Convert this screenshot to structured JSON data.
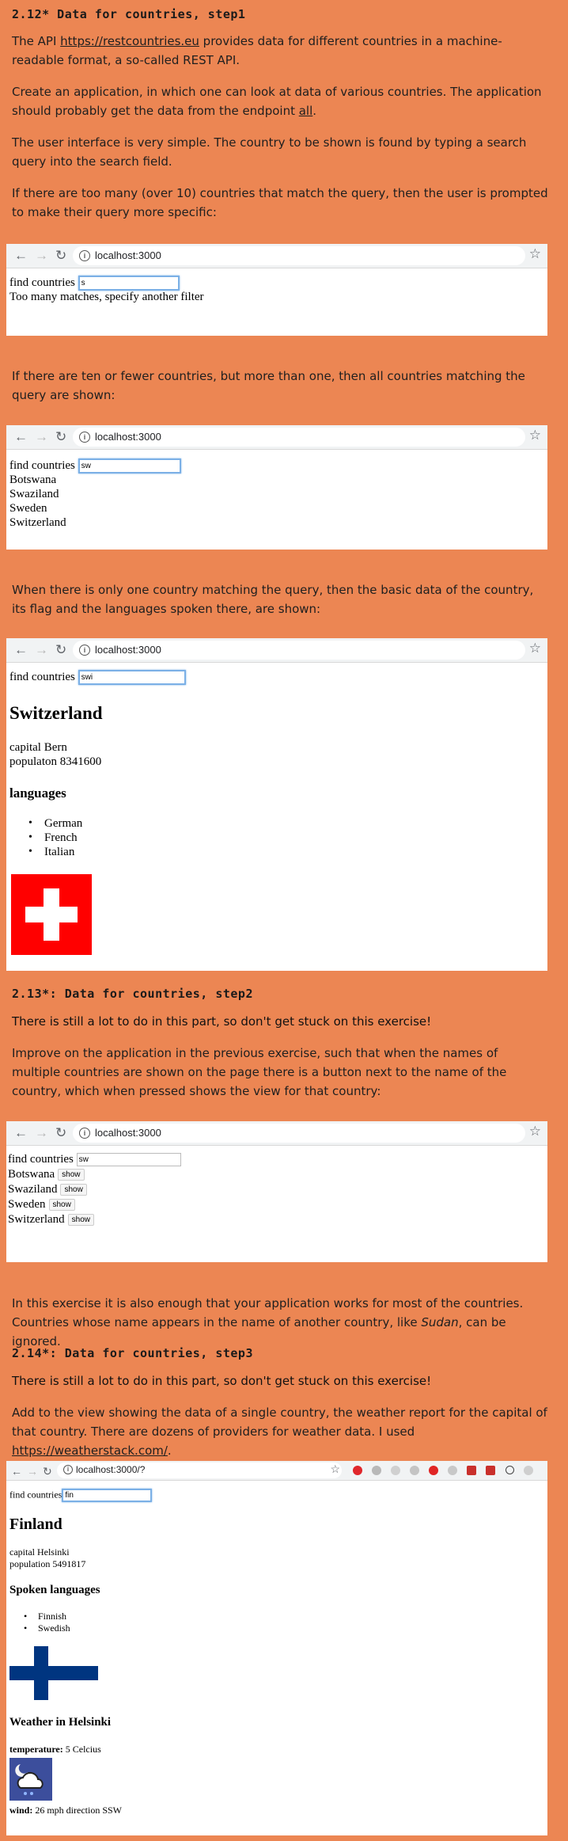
{
  "section1": {
    "title": "2.12* Data for countries, step1",
    "p1_a": "The API ",
    "p1_link": "https://restcountries.eu",
    "p1_b": " provides data for different countries in a machine-readable format, a so-called REST API.",
    "p2_a": "Create an application, in which one can look at data of various countries. The application should probably get the data from the endpoint ",
    "p2_link": "all",
    "p2_b": ".",
    "p3": "The user interface is very simple. The country to be shown is found by typing a search query into the search field.",
    "p4": "If there are too many (over 10) countries that match the query, then the user is prompted to make their query more specific:",
    "p5": "If there are ten or fewer countries, but more than one, then all countries matching the query are shown:",
    "p6": "When there is only one country matching the query, then the basic data of the country, its flag and the languages spoken there, are shown:"
  },
  "browser": {
    "url": "localhost:3000",
    "url2": "localhost:3000/?"
  },
  "shot1": {
    "find_label": "find countries",
    "query": "s",
    "message": "Too many matches, specify another filter"
  },
  "shot2": {
    "find_label": "find countries",
    "query": "sw",
    "countries": [
      "Botswana",
      "Swaziland",
      "Sweden",
      "Switzerland"
    ]
  },
  "shot3": {
    "find_label": "find countries",
    "query": "swi",
    "name": "Switzerland",
    "capital": "capital Bern",
    "population": "populaton 8341600",
    "languages_title": "languages",
    "languages": [
      "German",
      "French",
      "Italian"
    ],
    "flag_colors": {
      "bg": "#ff0000",
      "cross": "#ffffff"
    }
  },
  "section2": {
    "title": "2.13*: Data for countries, step2",
    "warning": "There is still a lot to do in this part, so don't get stuck on this exercise!",
    "p1": "Improve on the application in the previous exercise, such that when the names of multiple countries are shown on the page there is a button next to the name of the country, which when pressed shows the view for that country:",
    "p2_a": "In this exercise it is also enough that your application works for most of the countries. Countries whose name appears in the name of another country, like ",
    "p2_em": "Sudan",
    "p2_b": ", can be ignored."
  },
  "shot4": {
    "find_label": "find countries",
    "query": "sw",
    "countries": [
      "Botswana",
      "Swaziland",
      "Sweden",
      "Switzerland"
    ],
    "show_label": "show"
  },
  "section3": {
    "title": "2.14*: Data for countries, step3",
    "warning": "There is still a lot to do in this part, so don't get stuck on this exercise!",
    "p1_a": "Add to the view showing the data of a single country, the weather report for the capital of that country. There are dozens of providers for weather data. I used ",
    "p1_link": "https://weatherstack.com/",
    "p1_b": "."
  },
  "shot5": {
    "find_label": "find countries",
    "query": "fin",
    "name": "Finland",
    "capital": "capital Helsinki",
    "population": "population 5491817",
    "languages_title": "Spoken languages",
    "languages": [
      "Finnish",
      "Swedish"
    ],
    "weather_title": "Weather in Helsinki",
    "temp_label": "temperature:",
    "temp_value": " 5 Celcius",
    "wind_label": "wind:",
    "wind_value": " 26 mph direction SSW",
    "flag_colors": {
      "bg": "#ffffff",
      "cross": "#003580"
    }
  }
}
